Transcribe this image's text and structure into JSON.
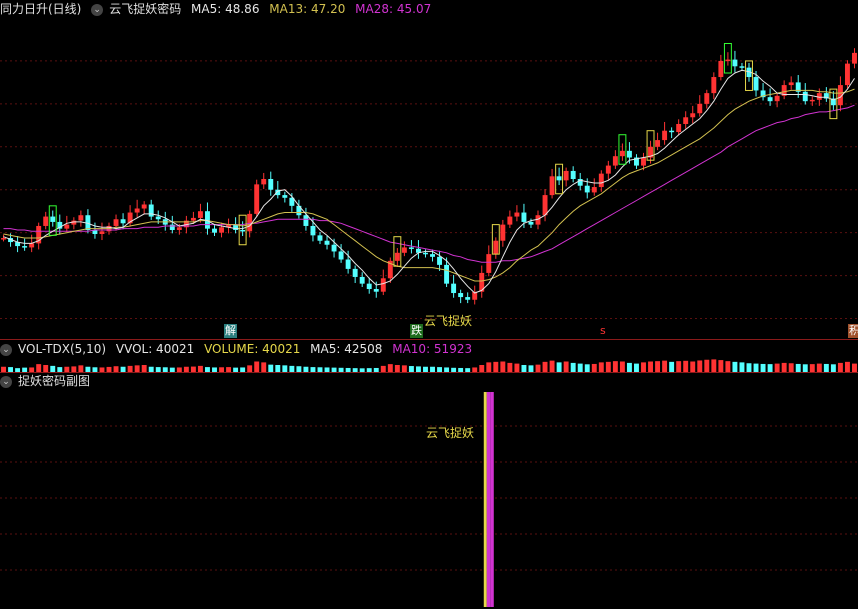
{
  "main_header": {
    "title": "同力日升(日线)",
    "indicator": "云飞捉妖密码",
    "ma5_label": "MA5: 48.86",
    "ma13_label": "MA13: 47.20",
    "ma28_label": "MA28: 45.07"
  },
  "vol_header": {
    "indicator": "VOL-TDX(5,10)",
    "vvol_label": "VVOL: 40021",
    "volume_label": "VOLUME: 40021",
    "ma5_label": "MA5: 42508",
    "ma10_label": "MA10: 51923"
  },
  "sub_header": {
    "indicator": "捉妖密码副图"
  },
  "annotations": {
    "jie": "解",
    "die": "跌",
    "yunfei_main": "云飞捉妖",
    "s_mark": "s",
    "last_mark": "积",
    "yunfei_sub": "云飞捉妖"
  },
  "colors": {
    "up": "#ff3333",
    "down": "#54ffff",
    "ma5": "#e6e6e6",
    "ma13": "#d2c050",
    "ma28": "#d133d1",
    "signal_green": "#33ff33",
    "signal_yellow": "#e6d84a",
    "grid": "#5a1010"
  },
  "chart_data": {
    "type": "candlestick",
    "ohlc_close": [
      39.6,
      39.3,
      39.0,
      38.9,
      39.2,
      40.5,
      41.2,
      40.8,
      40.3,
      40.6,
      40.9,
      41.3,
      40.2,
      39.9,
      40.1,
      40.5,
      41.0,
      40.7,
      41.5,
      41.8,
      42.1,
      41.2,
      41.0,
      40.6,
      40.2,
      40.4,
      40.9,
      41.1,
      41.6,
      40.3,
      40.0,
      40.4,
      40.6,
      40.2,
      40.1,
      41.4,
      43.6,
      44.0,
      43.2,
      42.8,
      42.6,
      42.0,
      41.3,
      40.5,
      39.8,
      39.4,
      39.1,
      38.6,
      38.0,
      37.3,
      36.7,
      36.2,
      35.8,
      35.6,
      36.6,
      37.9,
      38.5,
      38.9,
      38.8,
      38.5,
      38.4,
      38.2,
      37.6,
      36.2,
      35.5,
      35.2,
      35.0,
      35.6,
      37.0,
      38.4,
      39.4,
      40.6,
      41.2,
      41.5,
      40.8,
      40.6,
      41.3,
      42.8,
      44.2,
      43.9,
      44.6,
      44.0,
      43.5,
      43.0,
      43.4,
      44.4,
      45.0,
      45.7,
      46.1,
      45.6,
      45.0,
      45.6,
      46.4,
      46.9,
      47.6,
      47.5,
      48.1,
      48.6,
      48.9,
      49.6,
      50.4,
      51.6,
      52.8,
      52.9,
      52.4,
      52.3,
      51.6,
      50.6,
      50.1,
      49.8,
      50.2,
      51.0,
      51.2,
      50.5,
      49.8,
      49.9,
      50.4,
      50.0,
      49.5,
      51.0,
      52.6,
      53.4
    ],
    "ma5": [
      39.7,
      39.5,
      39.3,
      39.2,
      39.2,
      39.4,
      39.8,
      40.1,
      40.4,
      40.7,
      40.8,
      40.8,
      40.7,
      40.5,
      40.4,
      40.4,
      40.3,
      40.4,
      40.8,
      41.1,
      41.4,
      41.4,
      41.3,
      41.1,
      40.8,
      40.5,
      40.6,
      40.7,
      41.0,
      40.9,
      40.6,
      40.5,
      40.4,
      40.3,
      40.3,
      40.5,
      41.2,
      42.0,
      42.5,
      43.1,
      43.2,
      42.7,
      42.0,
      41.4,
      40.8,
      40.2,
      39.8,
      39.3,
      38.8,
      38.3,
      37.7,
      37.2,
      36.6,
      36.1,
      36.2,
      36.4,
      36.9,
      37.5,
      38.1,
      38.5,
      38.6,
      38.6,
      38.3,
      37.9,
      37.3,
      36.6,
      36.0,
      35.5,
      35.7,
      36.2,
      37.1,
      38.2,
      39.3,
      40.2,
      40.7,
      40.9,
      41.0,
      41.3,
      41.9,
      42.6,
      43.2,
      43.6,
      43.9,
      43.8,
      43.7,
      43.7,
      43.9,
      44.3,
      44.9,
      45.4,
      45.5,
      45.6,
      45.7,
      45.9,
      46.3,
      46.8,
      47.3,
      47.7,
      48.1,
      48.5,
      49.1,
      49.8,
      50.7,
      51.5,
      51.9,
      52.1,
      52.0,
      51.8,
      51.3,
      50.9,
      50.4,
      50.3,
      50.3,
      50.3,
      50.3,
      50.2,
      50.1,
      50.1,
      49.9,
      50.1,
      50.7,
      51.5
    ],
    "ma13": [
      39.9,
      39.8,
      39.7,
      39.6,
      39.6,
      39.6,
      39.7,
      39.8,
      39.9,
      40.0,
      40.1,
      40.2,
      40.3,
      40.3,
      40.3,
      40.3,
      40.4,
      40.4,
      40.5,
      40.6,
      40.7,
      40.8,
      40.8,
      40.8,
      40.8,
      40.8,
      40.8,
      40.8,
      40.9,
      40.9,
      40.8,
      40.7,
      40.6,
      40.6,
      40.5,
      40.6,
      40.8,
      41.0,
      41.2,
      41.4,
      41.5,
      41.5,
      41.5,
      41.5,
      41.4,
      41.2,
      41.0,
      40.6,
      40.2,
      39.8,
      39.4,
      39.0,
      38.6,
      38.2,
      37.9,
      37.7,
      37.5,
      37.4,
      37.4,
      37.4,
      37.4,
      37.4,
      37.3,
      37.2,
      37.0,
      36.8,
      36.6,
      36.4,
      36.4,
      36.5,
      36.7,
      37.0,
      37.4,
      37.9,
      38.3,
      38.7,
      39.0,
      39.5,
      40.0,
      40.6,
      41.1,
      41.6,
      42.0,
      42.3,
      42.6,
      42.9,
      43.3,
      43.7,
      44.1,
      44.4,
      44.6,
      44.8,
      45.0,
      45.2,
      45.5,
      45.8,
      46.1,
      46.4,
      46.7,
      47.0,
      47.4,
      47.8,
      48.3,
      48.8,
      49.2,
      49.5,
      49.8,
      50.0,
      50.2,
      50.3,
      50.4,
      50.5,
      50.6,
      50.6,
      50.6,
      50.6,
      50.5,
      50.5,
      50.4,
      50.4,
      50.5,
      50.7
    ],
    "ma28": [
      40.3,
      40.3,
      40.2,
      40.2,
      40.1,
      40.1,
      40.1,
      40.1,
      40.1,
      40.1,
      40.1,
      40.1,
      40.1,
      40.2,
      40.2,
      40.2,
      40.2,
      40.3,
      40.3,
      40.3,
      40.4,
      40.4,
      40.4,
      40.5,
      40.5,
      40.5,
      40.5,
      40.5,
      40.6,
      40.6,
      40.6,
      40.6,
      40.6,
      40.6,
      40.6,
      40.7,
      40.7,
      40.8,
      40.9,
      41.0,
      41.0,
      41.0,
      41.0,
      41.0,
      41.0,
      40.9,
      40.9,
      40.8,
      40.7,
      40.5,
      40.3,
      40.1,
      39.9,
      39.7,
      39.5,
      39.3,
      39.2,
      39.1,
      39.0,
      38.9,
      38.8,
      38.7,
      38.6,
      38.5,
      38.3,
      38.2,
      38.0,
      37.9,
      37.8,
      37.8,
      37.8,
      37.9,
      37.9,
      38.0,
      38.1,
      38.2,
      38.4,
      38.6,
      38.8,
      39.1,
      39.4,
      39.7,
      40.0,
      40.3,
      40.6,
      40.9,
      41.2,
      41.5,
      41.8,
      42.1,
      42.4,
      42.7,
      43.0,
      43.3,
      43.6,
      43.9,
      44.2,
      44.5,
      44.8,
      45.1,
      45.4,
      45.7,
      46.0,
      46.4,
      46.7,
      47.0,
      47.3,
      47.6,
      47.8,
      48.0,
      48.2,
      48.3,
      48.5,
      48.6,
      48.8,
      48.9,
      49.0,
      49.0,
      49.1,
      49.2,
      49.3,
      49.5
    ],
    "ylim": [
      32,
      56
    ],
    "volume": [
      30,
      28,
      22,
      25,
      26,
      45,
      40,
      35,
      28,
      30,
      32,
      38,
      30,
      27,
      26,
      29,
      33,
      30,
      35,
      38,
      40,
      30,
      28,
      27,
      25,
      26,
      30,
      31,
      35,
      28,
      26,
      27,
      28,
      25,
      26,
      38,
      60,
      55,
      42,
      40,
      38,
      35,
      33,
      30,
      28,
      27,
      26,
      25,
      24,
      23,
      22,
      21,
      22,
      23,
      35,
      45,
      40,
      38,
      34,
      32,
      30,
      30,
      28,
      26,
      24,
      23,
      22,
      26,
      40,
      55,
      58,
      60,
      52,
      48,
      40,
      38,
      42,
      58,
      65,
      55,
      60,
      52,
      48,
      44,
      46,
      55,
      58,
      62,
      60,
      52,
      48,
      55,
      60,
      62,
      65,
      58,
      62,
      64,
      60,
      66,
      70,
      72,
      68,
      62,
      58,
      55,
      50,
      48,
      46,
      45,
      48,
      52,
      50,
      46,
      44,
      45,
      48,
      46,
      44,
      52,
      58,
      48
    ],
    "vol_ylim": [
      0,
      80
    ],
    "sub_bar_index": 69
  }
}
